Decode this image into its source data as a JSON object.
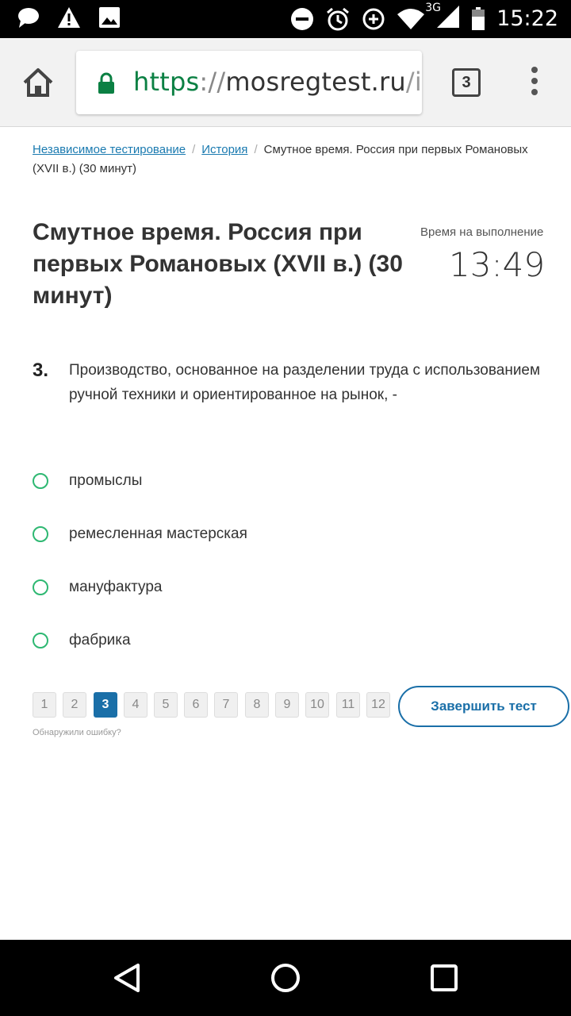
{
  "status_bar": {
    "time": "15:22",
    "network": "3G",
    "icons": [
      "chat-icon",
      "warning-icon",
      "image-icon",
      "do-not-disturb-icon",
      "alarm-icon",
      "data-saver-icon",
      "wifi-icon",
      "signal-icon",
      "battery-icon"
    ]
  },
  "browser": {
    "url_protocol": "https",
    "url_separator": "://",
    "url_host": "mosregtest.ru",
    "url_path": "/inde",
    "tab_count": "3"
  },
  "breadcrumb": {
    "items": [
      "Независимое тестирование",
      "История"
    ],
    "separator": "/",
    "current": "Смутное время. Россия при первых Романовых (XVII в.) (30 минут)"
  },
  "test": {
    "title": "Смутное время. Россия при первых Романовых (XVII в.) (30 минут)",
    "timer_label": "Время на выполнение",
    "timer_value": "13:49"
  },
  "question": {
    "number": "3.",
    "text": "Производство, основанное на разделении труда с использованием ручной техники и ориентированное на рынок, -",
    "answers": [
      "промыслы",
      "ремесленная мастерская",
      "мануфактура",
      "фабрика"
    ]
  },
  "pagination": {
    "pages": [
      "1",
      "2",
      "3",
      "4",
      "5",
      "6",
      "7",
      "8",
      "9",
      "10",
      "11",
      "12"
    ],
    "current": "3",
    "finish_label": "Завершить тест",
    "report_label": "Обнаружили ошибку?"
  },
  "colors": {
    "link": "#1a7ab0",
    "accent": "#1a6fa8",
    "radio": "#2eb872",
    "url_protocol": "#0b8043"
  }
}
